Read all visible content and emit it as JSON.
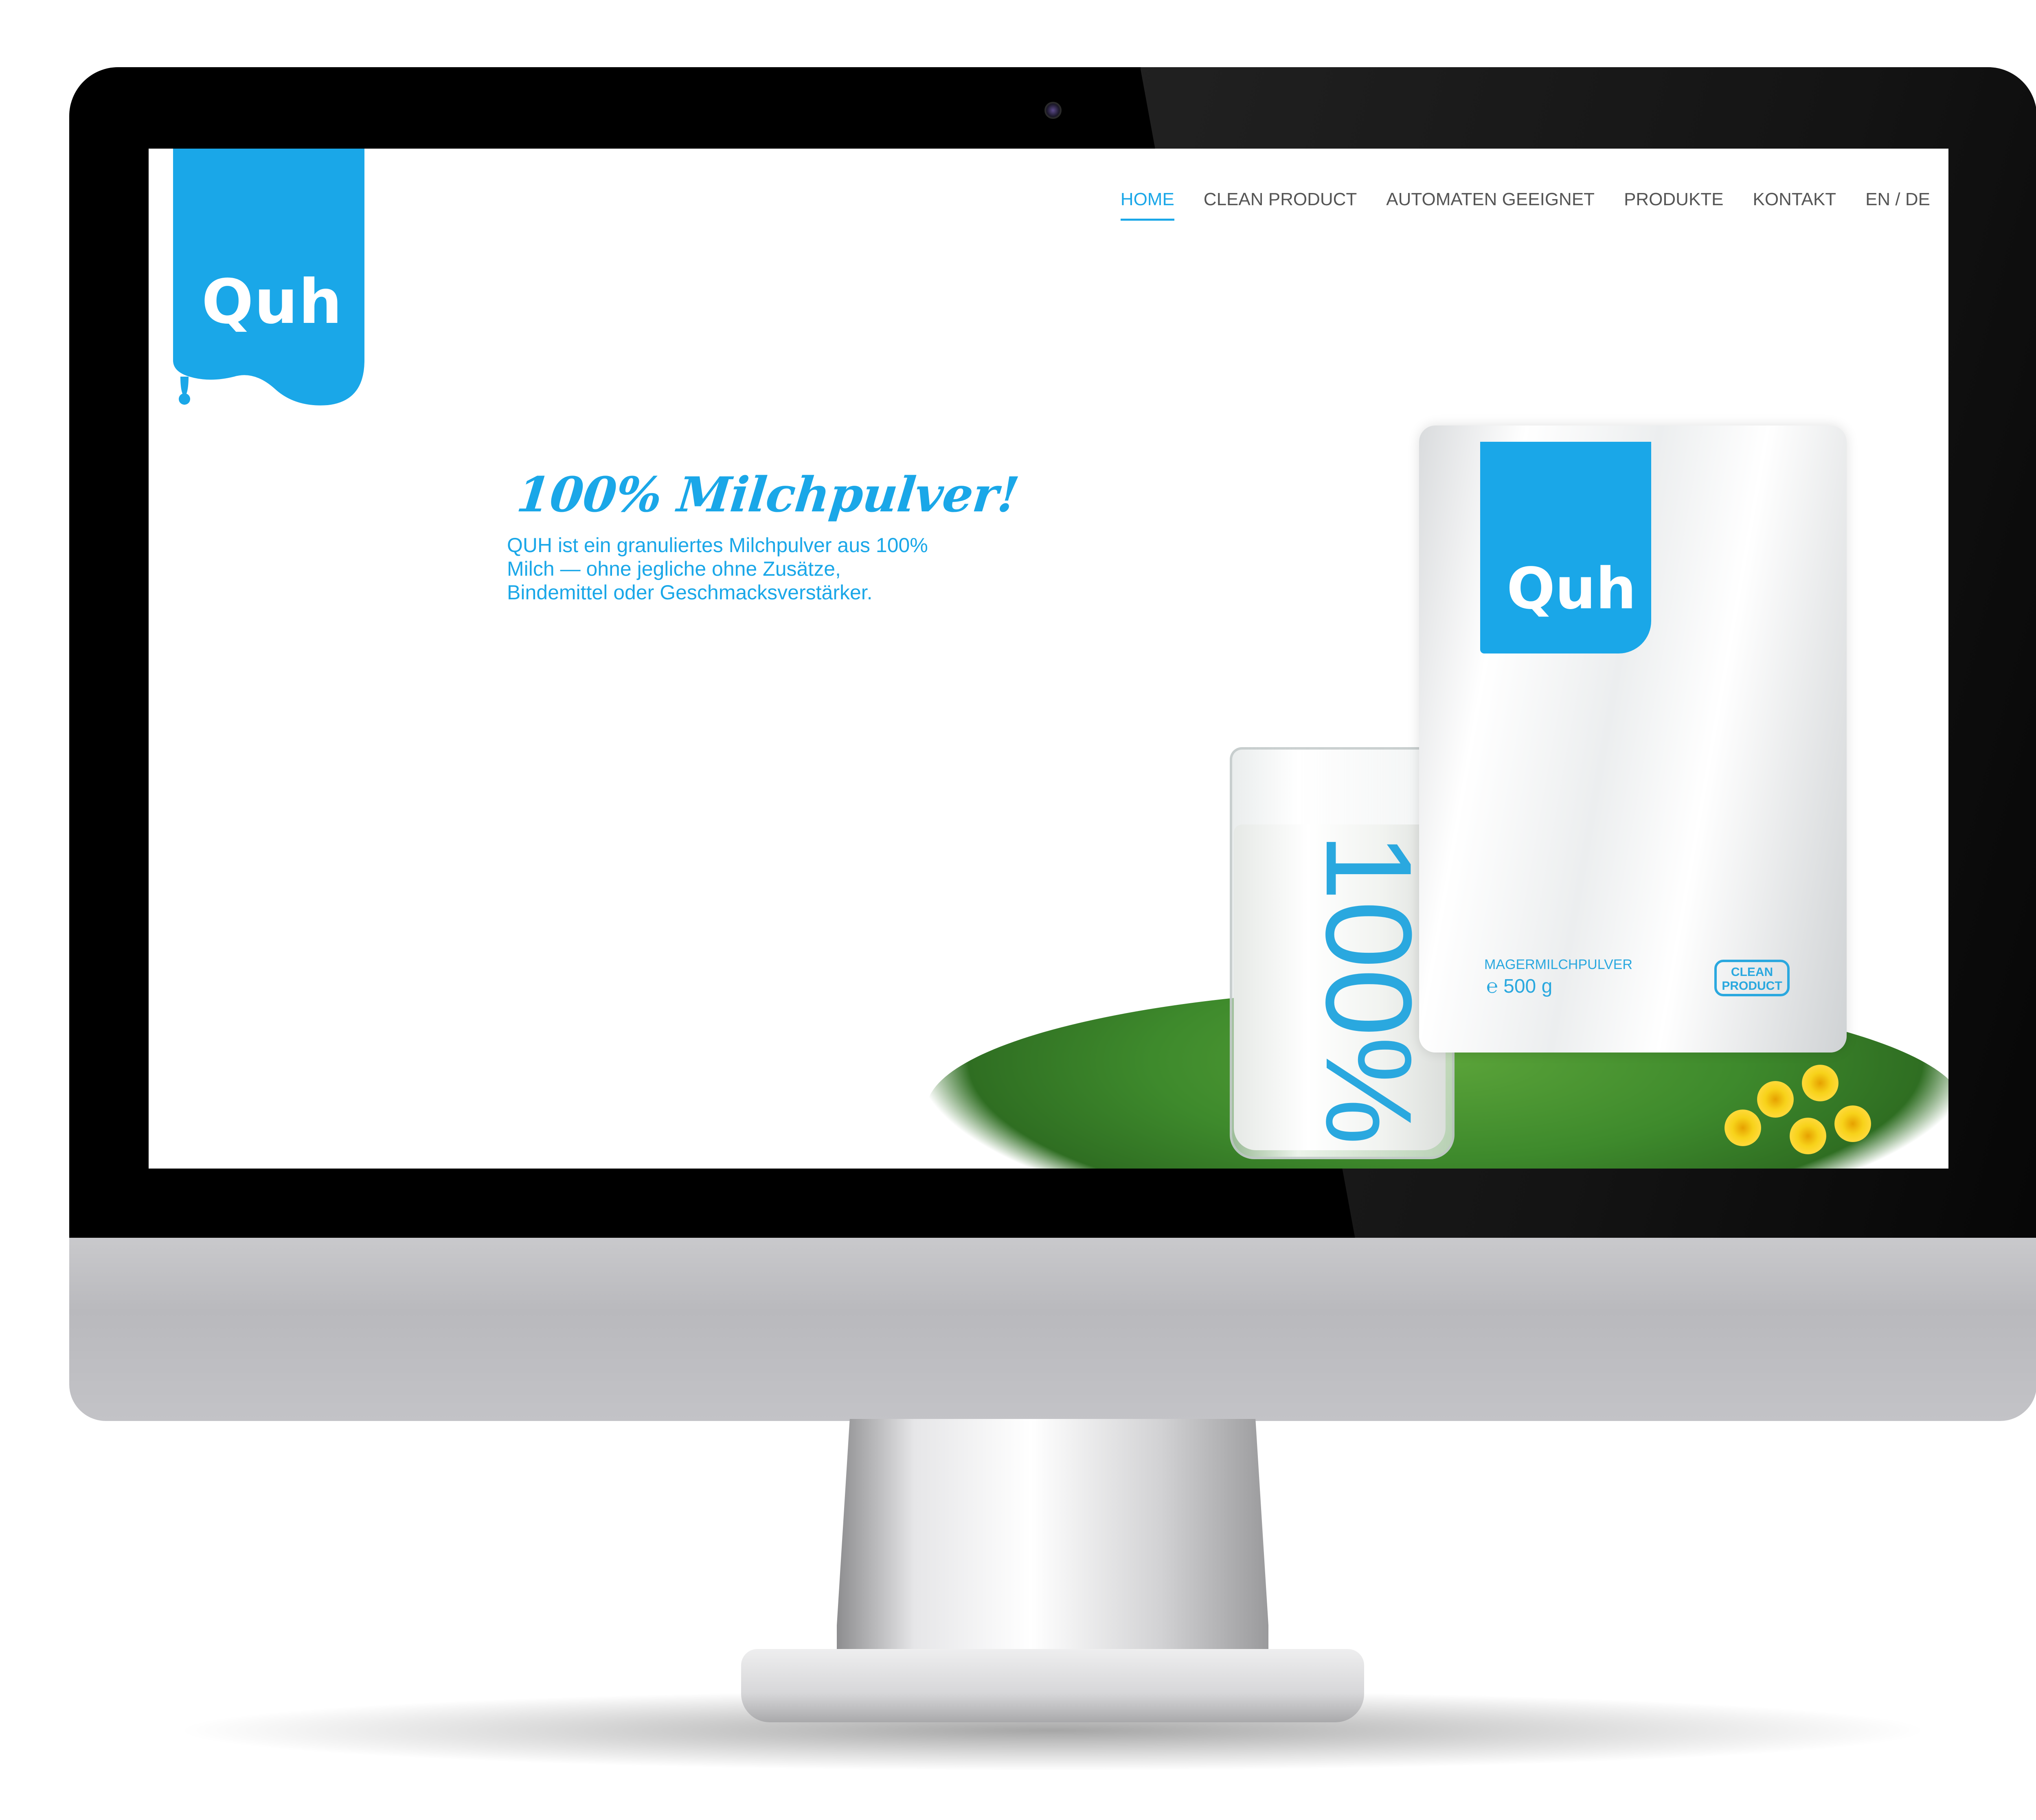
{
  "site": {
    "logo_text": "Quh",
    "brand_color": "#1aa7e8"
  },
  "nav": {
    "items": [
      {
        "label": "HOME",
        "active": true
      },
      {
        "label": "CLEAN PRODUCT",
        "active": false
      },
      {
        "label": "AUTOMATEN GEEIGNET",
        "active": false
      },
      {
        "label": "PRODUKTE",
        "active": false
      },
      {
        "label": "KONTAKT",
        "active": false
      },
      {
        "label": "EN / DE",
        "active": false
      }
    ]
  },
  "hero": {
    "title": "100% Milchpulver!",
    "text": "QUH ist ein granuliertes Milchpulver aus 100% Milch — ohne jegliche ohne Zusätze, Bindemittel oder Geschmacksverstärker."
  },
  "product": {
    "bag_logo": "Quh",
    "bag_percent": "100%",
    "bag_subtitle": "MAGERMILCHPULVER",
    "bag_weight": "℮  500 g",
    "badge": "CLEAN PRODUCT"
  },
  "icons": [
    "webcam-icon",
    "milk-drop-icon"
  ]
}
